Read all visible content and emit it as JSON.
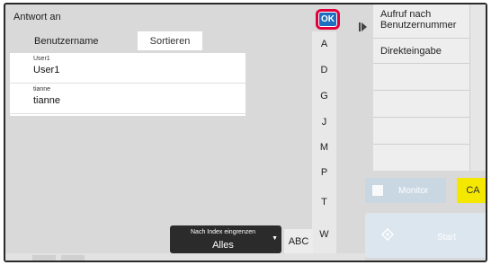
{
  "title": "Antwort an",
  "list_header": {
    "label": "Benutzername",
    "sort_label": "Sortieren"
  },
  "users": [
    {
      "small": "User1",
      "name": "User1"
    },
    {
      "small": "tianne",
      "name": "tianne"
    }
  ],
  "ok_label": "OK",
  "index_letters": [
    "A",
    "D",
    "G",
    "J",
    "M",
    "P",
    "T",
    "W"
  ],
  "right_panel": {
    "item1": "Aufruf nach Benutzernummer",
    "item2": "Direkteingabe"
  },
  "monitor_label": "Monitor",
  "ca_label": "CA",
  "start_label": "Start",
  "narrow": {
    "small": "Nach Index eingrenzen",
    "value": "Alles"
  },
  "abc_label": "ABC",
  "colors": {
    "ok_blue": "#1e6fbf",
    "highlight_red": "#e3003b",
    "ca_yellow": "#f5e800"
  }
}
